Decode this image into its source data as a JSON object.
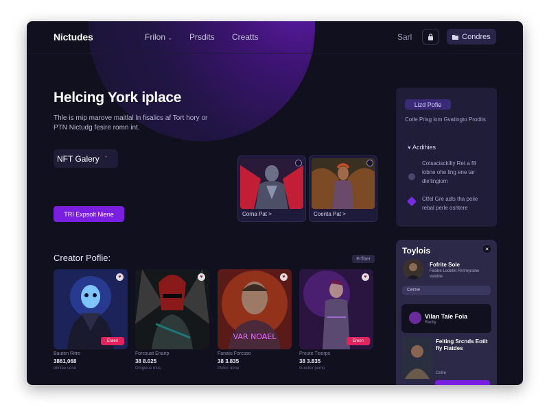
{
  "nav": {
    "brand": "Nictudes",
    "links": [
      {
        "label": "Frilon",
        "chevron": true
      },
      {
        "label": "Prsdits"
      },
      {
        "label": "Creatts"
      }
    ],
    "search_label": "Sarl",
    "button_label": "Condres",
    "icons": [
      "lock-icon",
      "folder-icon"
    ]
  },
  "hero": {
    "title": "Helcing York iplace",
    "subtitle": "Thle is rnip marove maitlal ln fisalics af Tort hory or PTN Nictudg fesire romn int.",
    "gallery_label": "NFT Galery",
    "cta_label": "TRI Expsolt Niene"
  },
  "featured": [
    {
      "caption": "Corna Pat",
      "arrow": ">"
    },
    {
      "caption": "Coenta Pat",
      "arrow": ">"
    }
  ],
  "creators": {
    "title": "Creator Poflie:",
    "tag": "Erflber",
    "cards": [
      {
        "tag": "Eraen",
        "name": "Bauten Ritre",
        "price": "3861,068",
        "small": "bbntee sone"
      },
      {
        "tag": "",
        "name": "Forcsuat Enarip",
        "price": "38 8.025",
        "small": "Omgieue mos"
      },
      {
        "tag": "",
        "name": "Fanatu Forcsso",
        "price": "38 3.835",
        "small": "Pldloc uone"
      },
      {
        "tag": "Ereon",
        "name": "Preute Tisorps",
        "price": "38 3.835",
        "small": "Guiellor pemo"
      }
    ],
    "art_text": "VAR NOAEL"
  },
  "right_panel": {
    "pill": "Lizd Pofie",
    "text": "Cotle Prisg lom Gvatingto Prodits",
    "heading": "Acdihies",
    "items": [
      {
        "text": "Cotsacisckilty Ret a f8 lobne ohe ling ene tar dle'lingiom"
      },
      {
        "text": "Ctfel Gre adls tha peiie rebal perle oshtere"
      }
    ]
  },
  "side_card": {
    "title": "Toylois",
    "profile_name": "Fofrite Sole",
    "profile_meta": "Fiioibe Lodetet Rrrlrnyraine veioble",
    "field": "Cerne",
    "highlight_title": "Vilan Taie Foia",
    "highlight_meta": "Ractly",
    "promo_text": "Feiting Srcnds Eotit fly Fiatdes",
    "promo_sub": "Crdre"
  }
}
